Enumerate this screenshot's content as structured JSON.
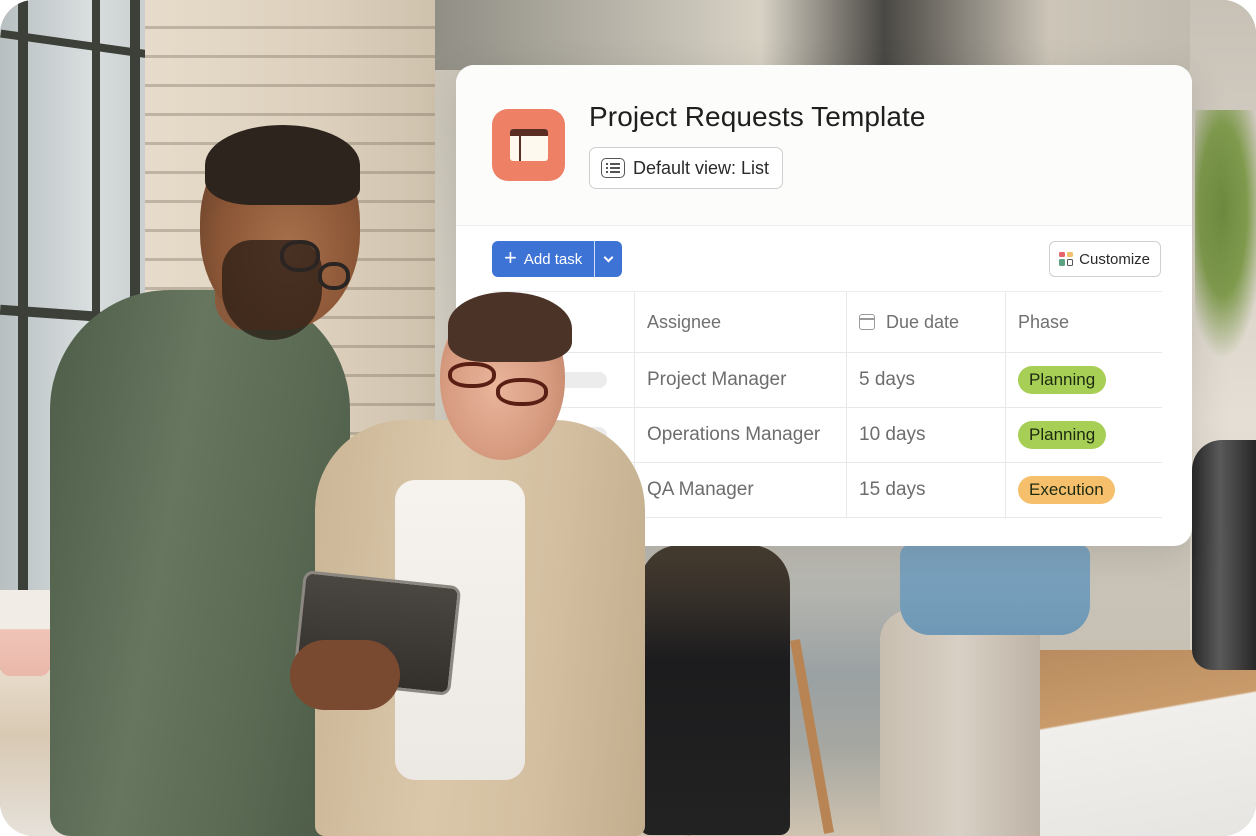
{
  "card": {
    "title": "Project Requests Template",
    "app_icon": "layout-window-icon",
    "app_icon_color": "#EE8066",
    "default_view_label": "Default view: List",
    "default_view_icon": "list-icon"
  },
  "toolbar": {
    "add_task_label": "Add task",
    "add_task_icon": "plus-icon",
    "add_task_dropdown_icon": "chevron-down-icon",
    "accent_color": "#3E73D6",
    "customize_label": "Customize",
    "customize_icon": "grid-icon",
    "customize_icon_colors": [
      "#E5646E",
      "#F0C06B",
      "#5DA283",
      "#FFFFFF"
    ]
  },
  "table": {
    "columns": [
      {
        "label": "",
        "icon": null
      },
      {
        "label": "Assignee",
        "icon": null
      },
      {
        "label": "Due date",
        "icon": "calendar-icon"
      },
      {
        "label": "Phase",
        "icon": null
      }
    ],
    "rows": [
      {
        "assignee": "Project Manager",
        "due": "5 days",
        "phase": "Planning",
        "phase_color": "#A7CE55"
      },
      {
        "assignee": "Operations Manager",
        "due": "10 days",
        "phase": "Planning",
        "phase_color": "#A7CE55"
      },
      {
        "assignee": "QA Manager",
        "due": "15 days",
        "phase": "Execution",
        "phase_color": "#F5BF6B"
      }
    ]
  },
  "background": {
    "description": "Office photo: two colleagues looking at a tablet"
  }
}
